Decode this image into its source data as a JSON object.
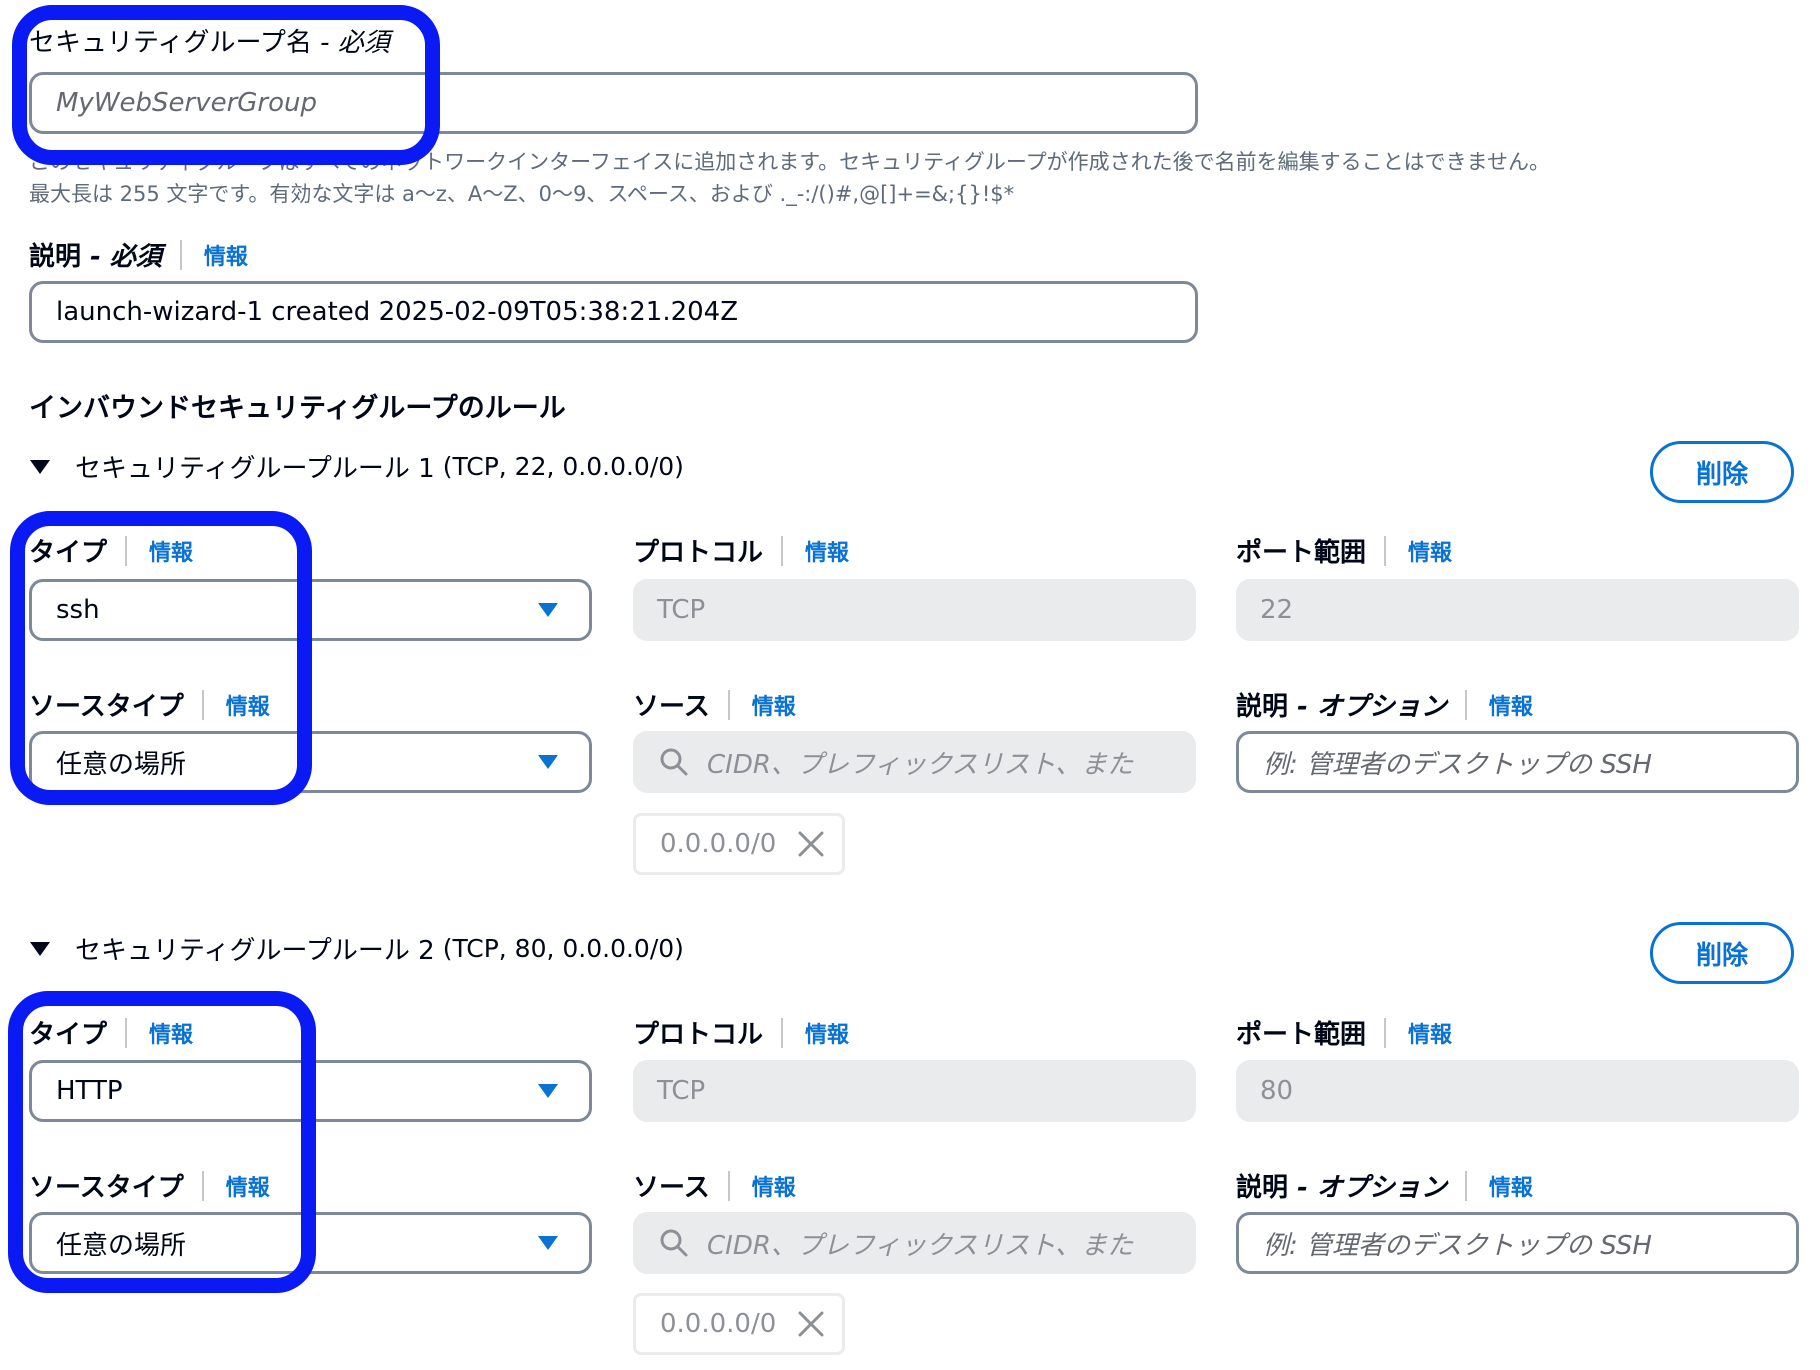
{
  "name_field": {
    "label": "セキュリティグループ名",
    "required": " - 必須",
    "placeholder": "MyWebServerGroup",
    "hint_line1": "このセキュリティグループはすべてのネットワークインターフェイスに追加されます。セキュリティグループが作成された後で名前を編集することはできません。",
    "hint_line2": "最大長は 255 文字です。有効な文字は a～z、A～Z、0～9、スペース、および ._-:/()#,@[]+=&;{}!$*"
  },
  "description_field": {
    "label": "説明",
    "required": " - 必須",
    "info": "情報",
    "value": "launch-wizard-1 created 2025-02-09T05:38:21.204Z"
  },
  "inbound_title": "インバウンドセキュリティグループのルール",
  "rules": [
    {
      "title": "セキュリティグループルール 1",
      "detail": "(TCP, 22, 0.0.0.0/0)",
      "delete_label": "削除",
      "type_label": "タイプ",
      "type_info": "情報",
      "type_value": "ssh",
      "protocol_label": "プロトコル",
      "protocol_info": "情報",
      "protocol_value": "TCP",
      "port_label": "ポート範囲",
      "port_info": "情報",
      "port_value": "22",
      "source_type_label": "ソースタイプ",
      "source_type_info": "情報",
      "source_type_value": "任意の場所",
      "source_label": "ソース",
      "source_info": "情報",
      "source_placeholder": "CIDR、プレフィックスリスト、また",
      "source_token": "0.0.0.0/0",
      "desc_label": "説明",
      "desc_optional": " - オプション",
      "desc_info": "情報",
      "desc_placeholder": "例: 管理者のデスクトップの SSH"
    },
    {
      "title": "セキュリティグループルール 2",
      "detail": "(TCP, 80, 0.0.0.0/0)",
      "delete_label": "削除",
      "type_label": "タイプ",
      "type_info": "情報",
      "type_value": "HTTP",
      "protocol_label": "プロトコル",
      "protocol_info": "情報",
      "protocol_value": "TCP",
      "port_label": "ポート範囲",
      "port_info": "情報",
      "port_value": "80",
      "source_type_label": "ソースタイプ",
      "source_type_info": "情報",
      "source_type_value": "任意の場所",
      "source_label": "ソース",
      "source_info": "情報",
      "source_placeholder": "CIDR、プレフィックスリスト、また",
      "source_token": "0.0.0.0/0",
      "desc_label": "説明",
      "desc_optional": " - オプション",
      "desc_info": "情報",
      "desc_placeholder": "例: 管理者のデスクトップの SSH"
    }
  ],
  "icons": {
    "caret": "caret-down-icon",
    "triangle": "triangle-down-icon",
    "search": "search-icon",
    "close": "close-icon"
  },
  "colors": {
    "link": "#0972d3",
    "highlight": "#0a1af5",
    "border": "#7d8998",
    "disabled_bg": "#e9ebed"
  }
}
